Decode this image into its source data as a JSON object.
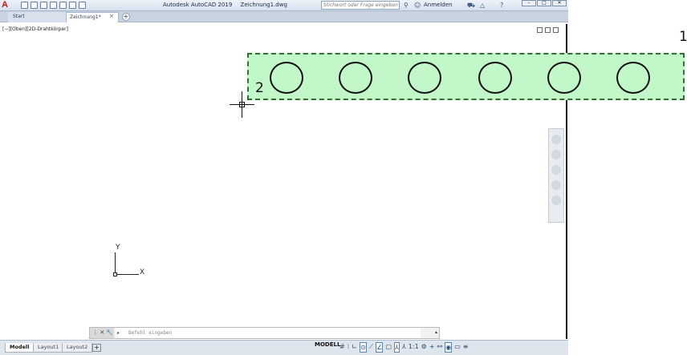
{
  "window": {
    "app_logo": "A",
    "title": "Autodesk AutoCAD 2019",
    "filename": "Zeichnung1.dwg",
    "search_placeholder": "Stichwort oder Frage eingeben",
    "signin": "Anmelden",
    "help": "?"
  },
  "tabs": {
    "start": "Start",
    "drawing": "Zeichnung1*",
    "close": "×",
    "add": "+"
  },
  "viewport": {
    "label": "[−][Oben][2D-Drahtkörper]"
  },
  "markers": {
    "one": "1",
    "two": "2"
  },
  "ucs": {
    "x": "X",
    "y": "Y"
  },
  "command": {
    "tools": "⋮ ✕ 🔧",
    "prompt_icon": "▸",
    "placeholder": "Befehl eingeben",
    "expand": "▴"
  },
  "status": {
    "layout_tabs": [
      "Modell",
      "Layout1",
      "Layout2"
    ],
    "add": "+",
    "mode": "MODELL",
    "scale": "1:1"
  },
  "colors": {
    "selection_fill": "#c2f7c9",
    "selection_border": "#3a6b36",
    "brand": "#c8151b"
  }
}
